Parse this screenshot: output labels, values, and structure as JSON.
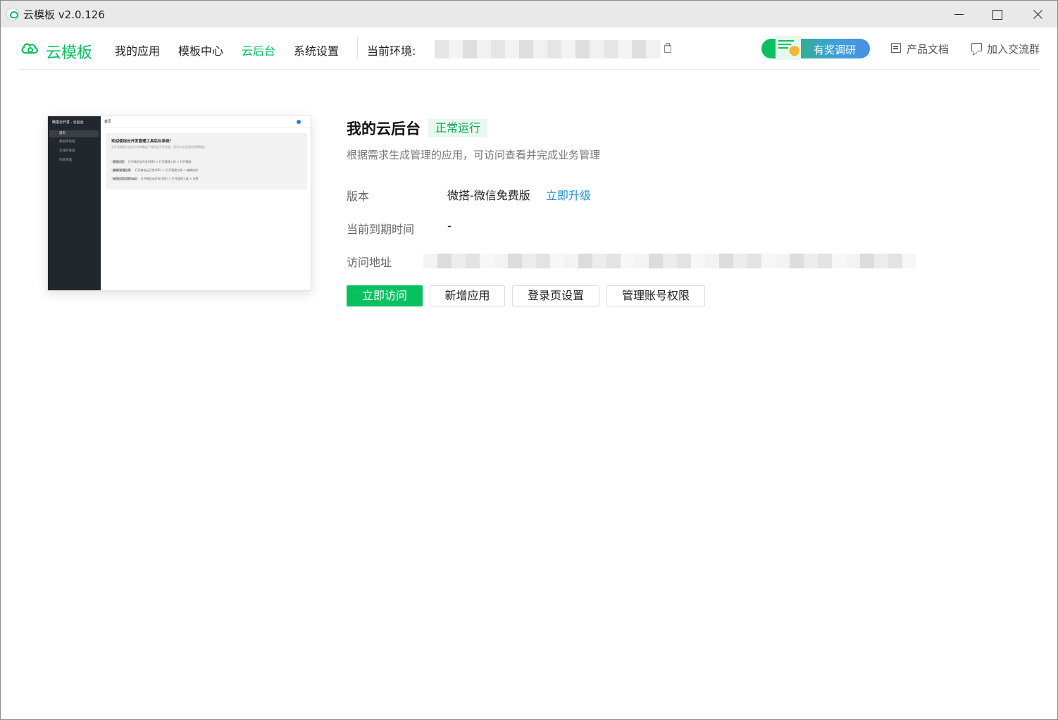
{
  "window": {
    "title": "云模板 v2.0.126"
  },
  "header": {
    "logo_text": "云模板",
    "nav": [
      "我的应用",
      "模板中心",
      "云后台",
      "系统设置"
    ],
    "active_nav": "云后台",
    "env_label": "当前环境:",
    "survey_label": "有奖调研",
    "docs_label": "产品文档",
    "group_label": "加入交流群"
  },
  "preview": {
    "brand": "微搭云开发 · 云后台",
    "menu": [
      "首页",
      "数据库管理",
      "云储存管理",
      "内容管理"
    ],
    "topbar": "首页",
    "welcome": "欢迎使用云开发管理工具后台系统！",
    "desc": "云开发管理工具后台系统集成了常用云开发功能，您可以在此轻松管理数据。",
    "rows": [
      {
        "tag": "管理应用",
        "text": "打开微信云开发(IDE) > 打开管理工具 > 打开模板"
      },
      {
        "tag": "编辑/新增应用",
        "text": "打开微信云开发(IDE) > 打开管理工具 > 编辑应用"
      },
      {
        "tag": "修改应用名称/logo",
        "text": "打开微信云开发(IDE) > 打开管理工具 > 设置"
      }
    ]
  },
  "detail": {
    "title": "我的云后台",
    "status": "正常运行",
    "description": "根据需求生成管理的应用，可访问查看并完成业务管理",
    "version_label": "版本",
    "version_value": "微搭-微信免费版",
    "upgrade_label": "立即升级",
    "expire_label": "当前到期时间",
    "expire_value": "-",
    "url_label": "访问地址"
  },
  "actions": {
    "visit": "立即访问",
    "add_app": "新增应用",
    "login_settings": "登录页设置",
    "account_perms": "管理账号权限"
  },
  "colors": {
    "brand": "#07c160",
    "link": "#1e8fd8",
    "status_bg": "#e8f8ee"
  }
}
